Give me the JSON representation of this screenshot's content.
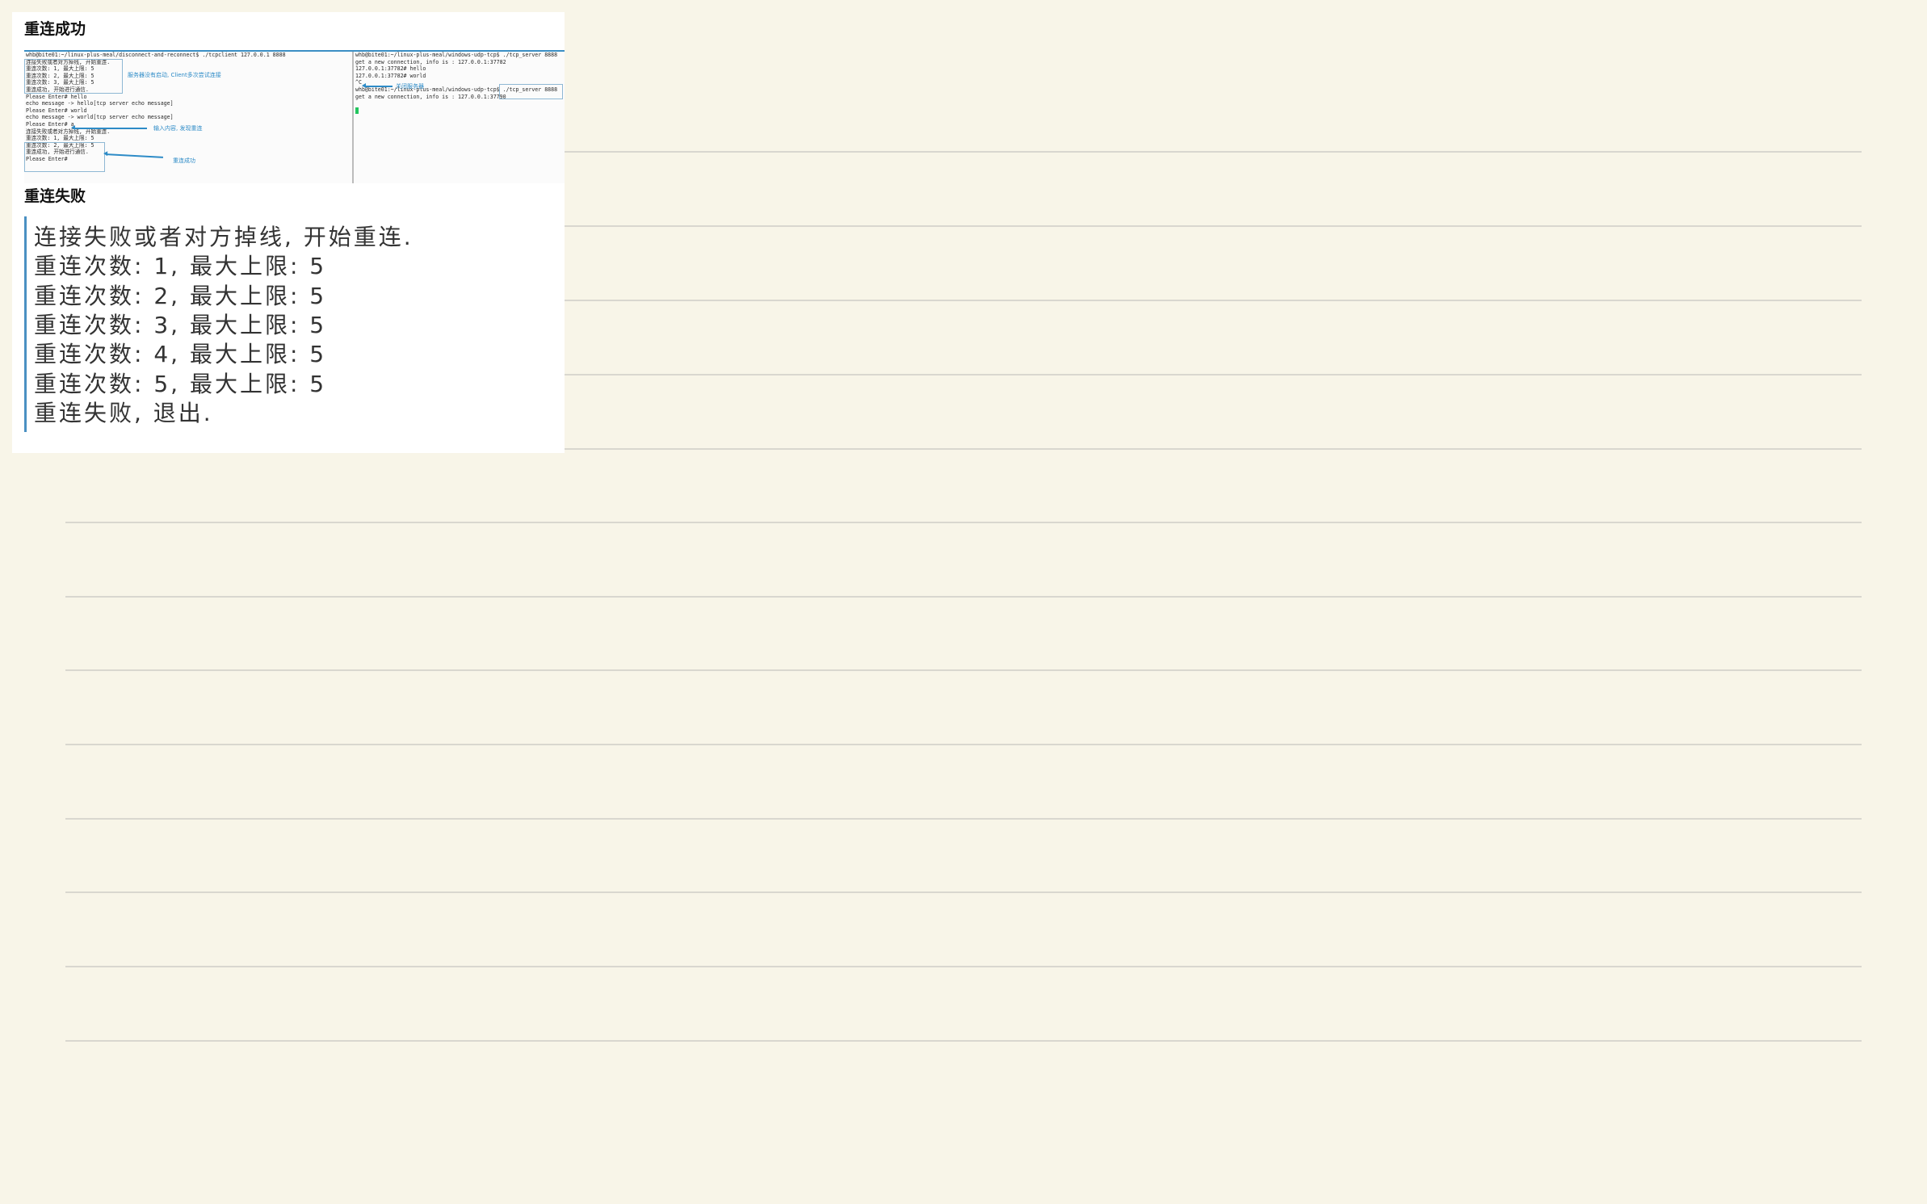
{
  "sections": {
    "success_title": "重连成功",
    "fail_title": "重连失败"
  },
  "terminal": {
    "left_lines": [
      "whb@bite01:~/linux-plus-meal/disconnect-and-reconnect$ ./tcpclient 127.0.0.1 8888",
      "连接失败或者对方掉线, 开始重连.",
      "重连次数: 1, 最大上限: 5",
      "重连次数: 2, 最大上限: 5",
      "重连次数: 3, 最大上限: 5",
      "重连成功, 开始进行通信.",
      "Please Enter# hello",
      "echo message -> hello[tcp server echo message]",
      "Please Enter# world",
      "echo message -> world[tcp server echo message]",
      "Please Enter# a",
      "连接失败或者对方掉线, 开始重连.",
      "重连次数: 1, 最大上限: 5",
      "重连次数: 2, 最大上限: 5",
      "重连成功, 开始进行通信.",
      "Please Enter# "
    ],
    "right_lines": [
      "whb@bite01:~/linux-plus-meal/windows-udp-tcp$ ./tcp_server 8888",
      "get a new connection, info is : 127.0.0.1:37782",
      "127.0.0.1:37782# hello",
      "127.0.0.1:37782# world",
      "^C",
      "whb@bite01:~/linux-plus-meal/windows-udp-tcp$ ./tcp_server 8888",
      "get a new connection, info is : 127.0.0.1:37790",
      ""
    ],
    "annotations": {
      "server_not_started": "服务器没有启动, Client多次尝试连接",
      "input_detect": "输入内容, 发现重连",
      "reconnect_ok": "重连成功",
      "kill_server": "关闭服务器"
    }
  },
  "fail_output": {
    "lines": [
      "连接失败或者对方掉线, 开始重连.",
      "重连次数: 1, 最大上限: 5",
      "重连次数: 2, 最大上限: 5",
      "重连次数: 3, 最大上限: 5",
      "重连次数: 4, 最大上限: 5",
      "重连次数: 5, 最大上限: 5",
      "重连失败, 退出."
    ]
  },
  "colors": {
    "background": "#f8f5e8",
    "accent": "#2d8bc7",
    "cursor": "#22c55e"
  }
}
